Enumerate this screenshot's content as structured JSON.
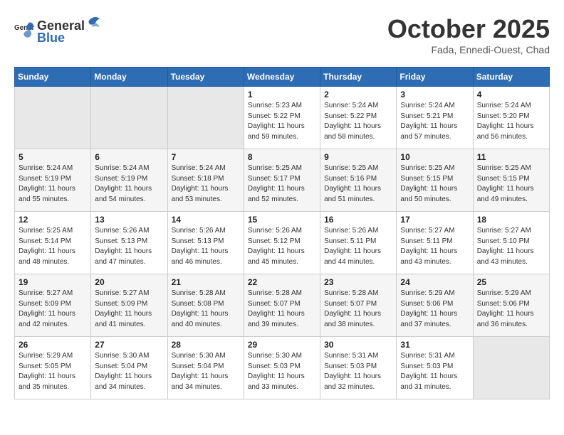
{
  "header": {
    "logo": {
      "general": "General",
      "blue": "Blue"
    },
    "title": "October 2025",
    "subtitle": "Fada, Ennedi-Ouest, Chad"
  },
  "days_of_week": [
    "Sunday",
    "Monday",
    "Tuesday",
    "Wednesday",
    "Thursday",
    "Friday",
    "Saturday"
  ],
  "weeks": [
    [
      {
        "day": "",
        "info": ""
      },
      {
        "day": "",
        "info": ""
      },
      {
        "day": "",
        "info": ""
      },
      {
        "day": "1",
        "info": "Sunrise: 5:23 AM\nSunset: 5:22 PM\nDaylight: 11 hours\nand 59 minutes."
      },
      {
        "day": "2",
        "info": "Sunrise: 5:24 AM\nSunset: 5:22 PM\nDaylight: 11 hours\nand 58 minutes."
      },
      {
        "day": "3",
        "info": "Sunrise: 5:24 AM\nSunset: 5:21 PM\nDaylight: 11 hours\nand 57 minutes."
      },
      {
        "day": "4",
        "info": "Sunrise: 5:24 AM\nSunset: 5:20 PM\nDaylight: 11 hours\nand 56 minutes."
      }
    ],
    [
      {
        "day": "5",
        "info": "Sunrise: 5:24 AM\nSunset: 5:19 PM\nDaylight: 11 hours\nand 55 minutes."
      },
      {
        "day": "6",
        "info": "Sunrise: 5:24 AM\nSunset: 5:19 PM\nDaylight: 11 hours\nand 54 minutes."
      },
      {
        "day": "7",
        "info": "Sunrise: 5:24 AM\nSunset: 5:18 PM\nDaylight: 11 hours\nand 53 minutes."
      },
      {
        "day": "8",
        "info": "Sunrise: 5:25 AM\nSunset: 5:17 PM\nDaylight: 11 hours\nand 52 minutes."
      },
      {
        "day": "9",
        "info": "Sunrise: 5:25 AM\nSunset: 5:16 PM\nDaylight: 11 hours\nand 51 minutes."
      },
      {
        "day": "10",
        "info": "Sunrise: 5:25 AM\nSunset: 5:15 PM\nDaylight: 11 hours\nand 50 minutes."
      },
      {
        "day": "11",
        "info": "Sunrise: 5:25 AM\nSunset: 5:15 PM\nDaylight: 11 hours\nand 49 minutes."
      }
    ],
    [
      {
        "day": "12",
        "info": "Sunrise: 5:25 AM\nSunset: 5:14 PM\nDaylight: 11 hours\nand 48 minutes."
      },
      {
        "day": "13",
        "info": "Sunrise: 5:26 AM\nSunset: 5:13 PM\nDaylight: 11 hours\nand 47 minutes."
      },
      {
        "day": "14",
        "info": "Sunrise: 5:26 AM\nSunset: 5:13 PM\nDaylight: 11 hours\nand 46 minutes."
      },
      {
        "day": "15",
        "info": "Sunrise: 5:26 AM\nSunset: 5:12 PM\nDaylight: 11 hours\nand 45 minutes."
      },
      {
        "day": "16",
        "info": "Sunrise: 5:26 AM\nSunset: 5:11 PM\nDaylight: 11 hours\nand 44 minutes."
      },
      {
        "day": "17",
        "info": "Sunrise: 5:27 AM\nSunset: 5:11 PM\nDaylight: 11 hours\nand 43 minutes."
      },
      {
        "day": "18",
        "info": "Sunrise: 5:27 AM\nSunset: 5:10 PM\nDaylight: 11 hours\nand 43 minutes."
      }
    ],
    [
      {
        "day": "19",
        "info": "Sunrise: 5:27 AM\nSunset: 5:09 PM\nDaylight: 11 hours\nand 42 minutes."
      },
      {
        "day": "20",
        "info": "Sunrise: 5:27 AM\nSunset: 5:09 PM\nDaylight: 11 hours\nand 41 minutes."
      },
      {
        "day": "21",
        "info": "Sunrise: 5:28 AM\nSunset: 5:08 PM\nDaylight: 11 hours\nand 40 minutes."
      },
      {
        "day": "22",
        "info": "Sunrise: 5:28 AM\nSunset: 5:07 PM\nDaylight: 11 hours\nand 39 minutes."
      },
      {
        "day": "23",
        "info": "Sunrise: 5:28 AM\nSunset: 5:07 PM\nDaylight: 11 hours\nand 38 minutes."
      },
      {
        "day": "24",
        "info": "Sunrise: 5:29 AM\nSunset: 5:06 PM\nDaylight: 11 hours\nand 37 minutes."
      },
      {
        "day": "25",
        "info": "Sunrise: 5:29 AM\nSunset: 5:06 PM\nDaylight: 11 hours\nand 36 minutes."
      }
    ],
    [
      {
        "day": "26",
        "info": "Sunrise: 5:29 AM\nSunset: 5:05 PM\nDaylight: 11 hours\nand 35 minutes."
      },
      {
        "day": "27",
        "info": "Sunrise: 5:30 AM\nSunset: 5:04 PM\nDaylight: 11 hours\nand 34 minutes."
      },
      {
        "day": "28",
        "info": "Sunrise: 5:30 AM\nSunset: 5:04 PM\nDaylight: 11 hours\nand 34 minutes."
      },
      {
        "day": "29",
        "info": "Sunrise: 5:30 AM\nSunset: 5:03 PM\nDaylight: 11 hours\nand 33 minutes."
      },
      {
        "day": "30",
        "info": "Sunrise: 5:31 AM\nSunset: 5:03 PM\nDaylight: 11 hours\nand 32 minutes."
      },
      {
        "day": "31",
        "info": "Sunrise: 5:31 AM\nSunset: 5:03 PM\nDaylight: 11 hours\nand 31 minutes."
      },
      {
        "day": "",
        "info": ""
      }
    ]
  ]
}
